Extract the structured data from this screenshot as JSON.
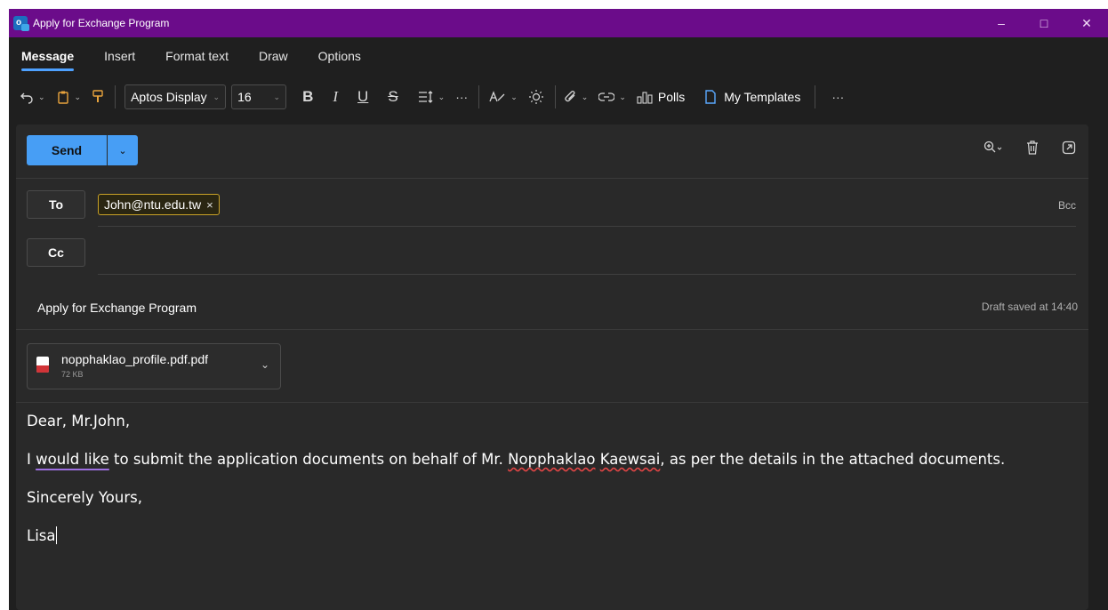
{
  "window": {
    "title": "Apply for Exchange Program",
    "controls": [
      "–",
      "□",
      "✕"
    ]
  },
  "ribbon": {
    "tabs": [
      "Message",
      "Insert",
      "Format text",
      "Draw",
      "Options"
    ],
    "active_tab": "Message"
  },
  "toolbar": {
    "font_name": "Aptos Display",
    "font_size": "16",
    "bold": "B",
    "italic": "I",
    "underline": "U",
    "strike": "S",
    "more": "···",
    "polls_label": "Polls",
    "templates_label": "My Templates",
    "overflow": "···"
  },
  "compose": {
    "send_label": "Send",
    "to_label": "To",
    "cc_label": "Cc",
    "bcc_label": "Bcc",
    "recipient": "John@ntu.edu.tw",
    "recipient_remove": "×",
    "subject": "Apply for Exchange Program",
    "draft_status": "Draft saved at 14:40",
    "attachment": {
      "name": "nopphaklao_profile.pdf.pdf",
      "size": "72 KB"
    },
    "body": {
      "greeting": "Dear, Mr.John,",
      "line_i": "I ",
      "line_would_like": "would like",
      "line_mid": " to submit the application documents on behalf of Mr. ",
      "name_first": "Nopphaklao",
      "name_space": " ",
      "name_last": "Kaewsai",
      "line_end": ", as per the details in the attached documents.",
      "closing": "Sincerely Yours,",
      "signature": "Lisa"
    }
  },
  "colors": {
    "titlebar": "#6b0c8a",
    "accent": "#479ef5",
    "background": "#1f1f1f",
    "compose_bg": "#292929"
  }
}
